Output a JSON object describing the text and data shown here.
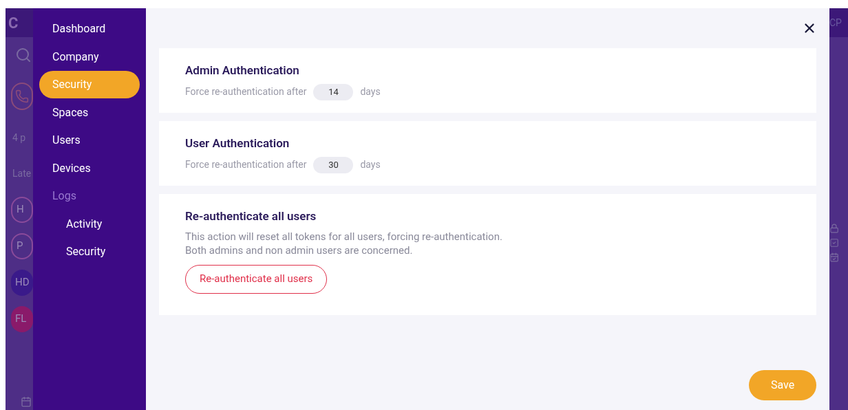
{
  "background_app": {
    "logo": "C",
    "left_items": [
      {
        "kind": "search"
      },
      {
        "kind": "phone"
      },
      {
        "kind": "text",
        "text": "4 p"
      },
      {
        "kind": "text",
        "text": "Late"
      },
      {
        "kind": "avatar",
        "text": "H",
        "filled": false,
        "color": "#8a4a9a"
      },
      {
        "kind": "avatar",
        "text": "P",
        "filled": false,
        "color": "#8a4a9a"
      },
      {
        "kind": "avatar",
        "text": "HD",
        "filled": true,
        "color": "#3a1a8a"
      },
      {
        "kind": "avatar",
        "text": "FL",
        "filled": true,
        "color": "#8a1a6a"
      }
    ],
    "profile": "CP"
  },
  "nav": {
    "items": [
      {
        "label": "Dashboard",
        "kind": "link",
        "selected": false
      },
      {
        "label": "Company",
        "kind": "link",
        "selected": false
      },
      {
        "label": "Security",
        "kind": "link",
        "selected": true
      },
      {
        "label": "Spaces",
        "kind": "link",
        "selected": false
      },
      {
        "label": "Users",
        "kind": "link",
        "selected": false
      },
      {
        "label": "Devices",
        "kind": "link",
        "selected": false
      },
      {
        "label": "Logs",
        "kind": "group",
        "selected": false,
        "children": [
          {
            "label": "Activity",
            "kind": "link",
            "selected": false
          },
          {
            "label": "Security",
            "kind": "link",
            "selected": false
          }
        ]
      }
    ]
  },
  "sections": [
    {
      "kind": "duration",
      "title": "Admin Authentication",
      "label": "Force re-authentication after",
      "value": "14",
      "unit": "days"
    },
    {
      "kind": "duration",
      "title": "User Authentication",
      "label": "Force re-authentication after",
      "value": "30",
      "unit": "days"
    },
    {
      "kind": "action",
      "title": "Re-authenticate all users",
      "lines": [
        "This action will reset all tokens for all users, forcing re-authentication.",
        "Both admins and non admin users are concerned."
      ],
      "button": "Re-authenticate all users"
    }
  ],
  "save_button": "Save"
}
